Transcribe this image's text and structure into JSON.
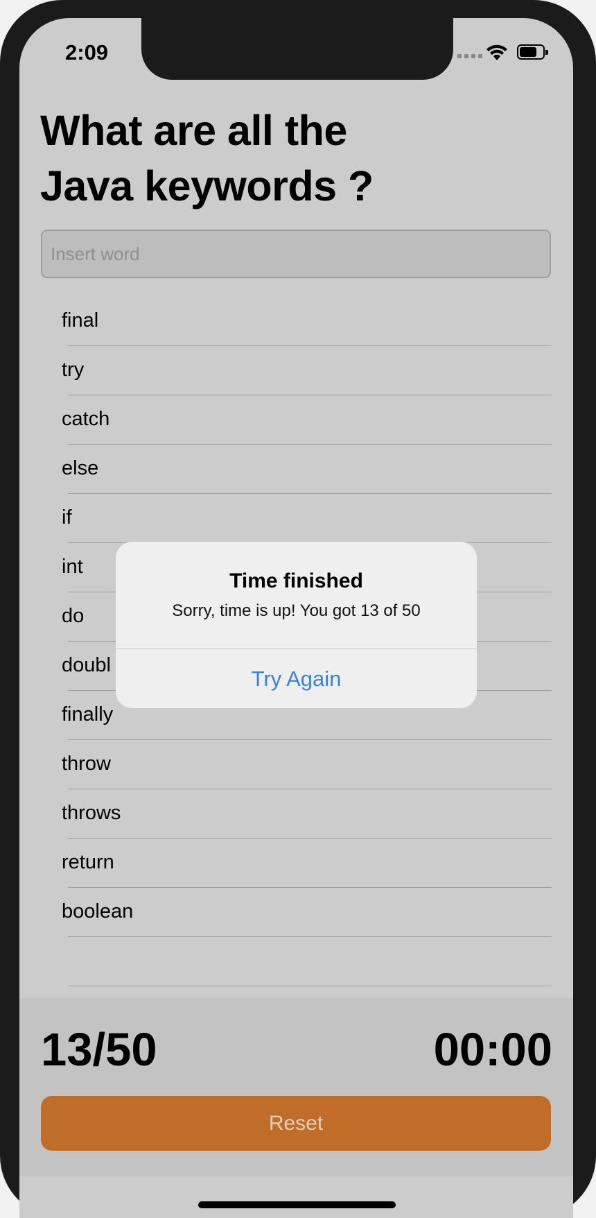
{
  "status_bar": {
    "time": "2:09"
  },
  "question": {
    "line1": "What are all the",
    "line2": "Java keywords ?"
  },
  "search": {
    "placeholder": "Insert word"
  },
  "words": [
    "final",
    "try",
    "catch",
    "else",
    "if",
    "int",
    "do",
    "doubl",
    "finally",
    "throw",
    "throws",
    "return",
    "boolean",
    ""
  ],
  "footer": {
    "score": "13/50",
    "timer": "00:00",
    "reset_label": "Reset"
  },
  "alert": {
    "title": "Time finished",
    "message": "Sorry, time is up! You got 13 of 50",
    "button_label": "Try Again"
  },
  "colors": {
    "accent": "#c06d29",
    "alert_button": "#3c7fe0"
  }
}
